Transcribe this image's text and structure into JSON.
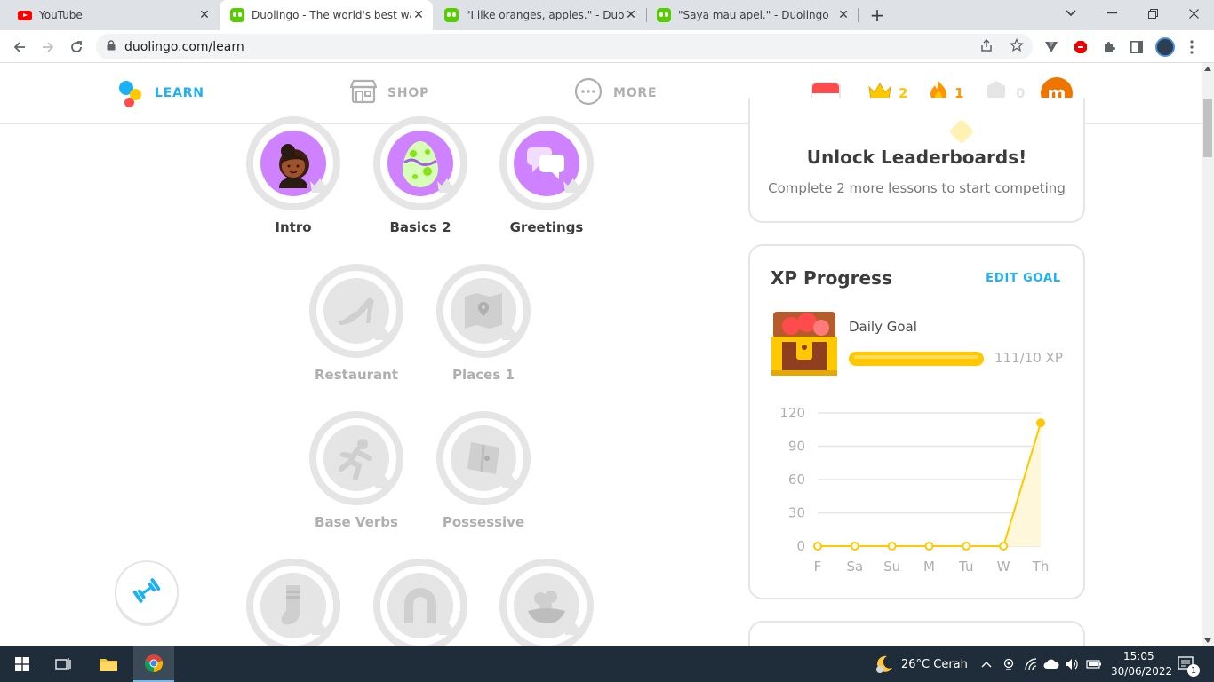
{
  "browser": {
    "tabs": [
      {
        "title": "YouTube",
        "icon": "youtube-icon",
        "active": false
      },
      {
        "title": "Duolingo - The world's best way",
        "icon": "duolingo-icon",
        "active": true
      },
      {
        "title": "\"I like oranges, apples.\" - Duolingo",
        "icon": "duolingo-icon",
        "active": false
      },
      {
        "title": "\"Saya mau apel.\" - Duolingo",
        "icon": "duolingo-icon",
        "active": false
      }
    ],
    "url": "duolingo.com/learn"
  },
  "header": {
    "nav": [
      {
        "label": "LEARN",
        "active": true
      },
      {
        "label": "SHOP",
        "active": false
      },
      {
        "label": "MORE",
        "active": false
      }
    ],
    "crowns": "2",
    "streak": "1",
    "gems": "0",
    "avatar_letter": "m"
  },
  "skills": {
    "row1": [
      {
        "label": "Intro",
        "locked": false
      },
      {
        "label": "Basics 2",
        "locked": false
      },
      {
        "label": "Greetings",
        "locked": false
      }
    ],
    "row2": [
      {
        "label": "Restaurant",
        "locked": true
      },
      {
        "label": "Places 1",
        "locked": true
      }
    ],
    "row3": [
      {
        "label": "Base Verbs",
        "locked": true
      },
      {
        "label": "Possessive",
        "locked": true
      }
    ]
  },
  "leaderboard": {
    "title": "Unlock Leaderboards!",
    "subtitle": "Complete 2 more lessons to start competing"
  },
  "xp": {
    "title": "XP Progress",
    "edit_goal": "EDIT GOAL",
    "daily_goal": "Daily Goal",
    "progress_text": "111/10 XP",
    "progress_fraction": 1.0
  },
  "chart_data": {
    "type": "line",
    "categories": [
      "F",
      "Sa",
      "Su",
      "M",
      "Tu",
      "W",
      "Th"
    ],
    "values": [
      0,
      0,
      0,
      0,
      0,
      0,
      111
    ],
    "yticks": [
      120,
      90,
      60,
      30,
      0
    ],
    "ylim": [
      0,
      120
    ],
    "color": "#ffc800"
  },
  "taskbar": {
    "weather": "26°C  Cerah",
    "time": "15:05",
    "date": "30/06/2022",
    "notifications": "1"
  },
  "colors": {
    "learn_blue": "#1cb0f6",
    "skill_purple": "#ce82ff",
    "gold": "#ffc800",
    "streak_orange": "#ff9600",
    "locked_gray": "#afafaf"
  }
}
